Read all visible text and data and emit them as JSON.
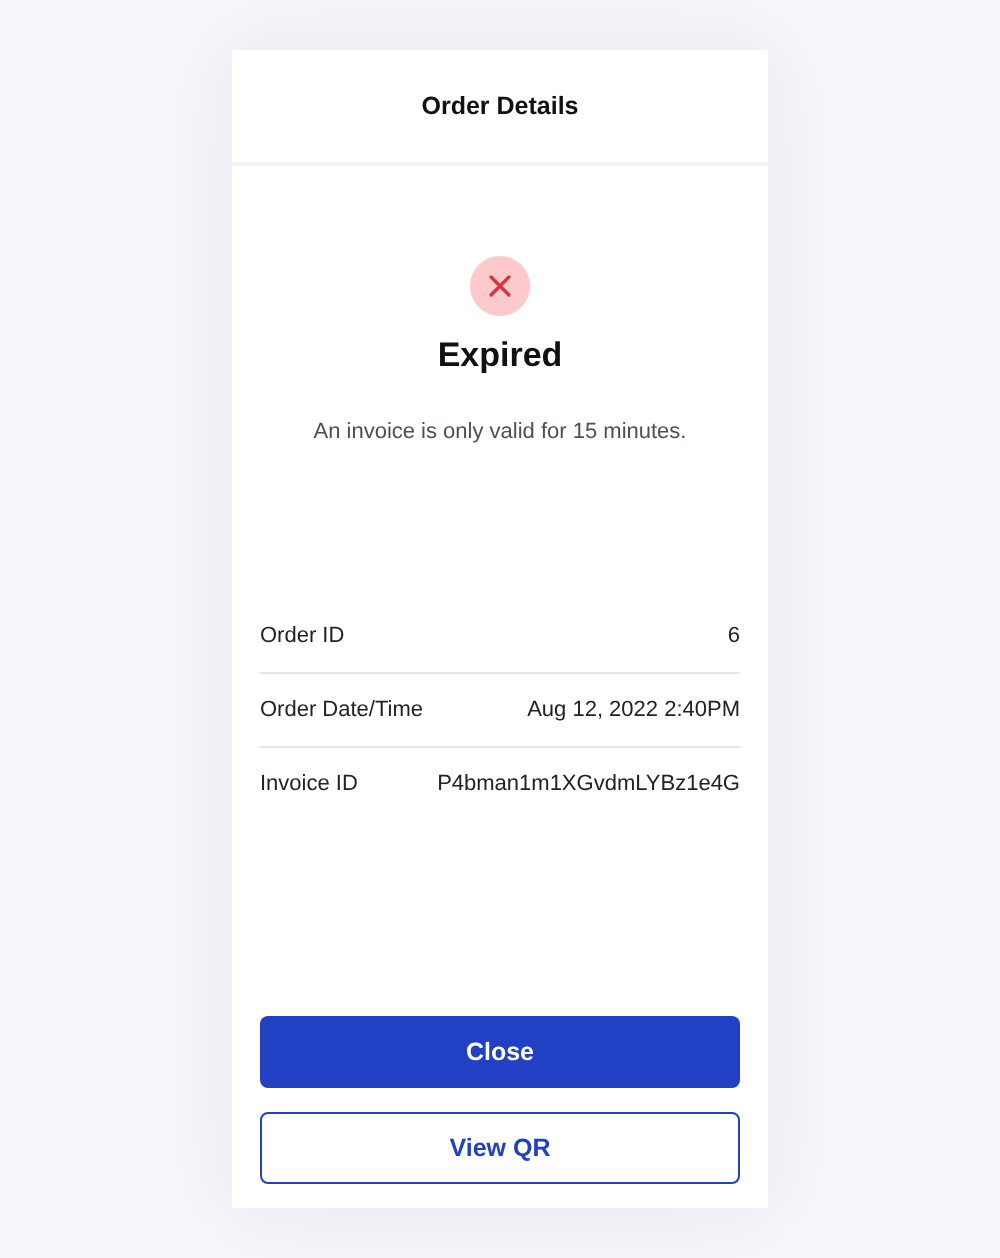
{
  "header": {
    "title": "Order Details"
  },
  "status": {
    "kind": "error",
    "title": "Expired",
    "message": "An invoice is only valid for 15 minutes."
  },
  "details": [
    {
      "label": "Order ID",
      "value": "6"
    },
    {
      "label": "Order Date/Time",
      "value": "Aug 12, 2022 2:40PM"
    },
    {
      "label": "Invoice ID",
      "value": "P4bman1m1XGvdmLYBz1e4G"
    }
  ],
  "buttons": [
    {
      "label": "Close",
      "kind": "primary"
    },
    {
      "label": "View QR",
      "kind": "secondary"
    }
  ]
}
